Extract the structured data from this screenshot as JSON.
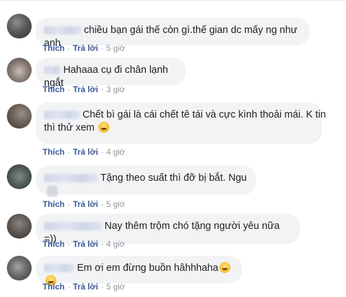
{
  "comments": [
    {
      "text": "chiều bạn gái thế còn gì.thế gian dc mấy ng như anh",
      "like_label": "Thích",
      "reply_label": "Trả lời",
      "time": "5 giờ",
      "separator": "·"
    },
    {
      "text": "Hahaaa cụ đi chân lạnh ngắt",
      "like_label": "Thích",
      "reply_label": "Trả lời",
      "time": "3 giờ",
      "separator": "·"
    },
    {
      "text_line1": "Chết bì gái là cái chết tê tái và cực kình thoải mái. K tin",
      "text_line2": "thì thử xem",
      "emoji": "smile-emoji",
      "like_label": "Thích",
      "reply_label": "Trả lời",
      "time": "4 giờ",
      "separator": "·"
    },
    {
      "text": "Tặng theo suất thì đỡ bị bắt. Ngu",
      "like_label": "Thích",
      "reply_label": "Trả lời",
      "time": "5 giờ",
      "separator": "·"
    },
    {
      "text": "Nay thêm trộm chó tặng người yêu nữa =))",
      "like_label": "Thích",
      "reply_label": "Trả lời",
      "time": "4 giờ",
      "separator": "·"
    },
    {
      "text": "Em ơi em đừng buồn hâhhhaha",
      "emoji": "rofl-emoji",
      "like_label": "Thích",
      "reply_label": "Trả lời",
      "time": "5 giờ",
      "separator": "·"
    }
  ],
  "colors": {
    "bubble": "#f2f3f5",
    "link": "#385898",
    "meta": "#90949c",
    "text": "#1c1e21"
  }
}
